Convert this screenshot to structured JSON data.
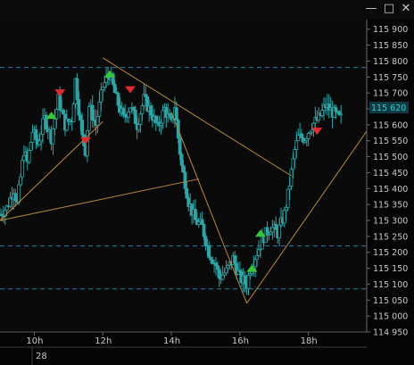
{
  "window": {
    "minimize_glyph": "—",
    "maximize_glyph": "□",
    "close_glyph": "✕"
  },
  "colors": {
    "background": "#0a0a0a",
    "candle": "#2aa6a6",
    "trendline": "#b98a3a",
    "hline": "#1f7fa8",
    "buy_marker": "#35c935",
    "sell_marker": "#e02b2b",
    "price_label_bg": "#0d3a45",
    "price_label_text": "#2fd0d0"
  },
  "chart_data": {
    "type": "candlestick",
    "current_price": "115 620",
    "y_ticks": [
      "115 900",
      "115 850",
      "115 800",
      "115 750",
      "115 700",
      "115 650",
      "115 600",
      "115 550",
      "115 500",
      "115 450",
      "115 400",
      "115 350",
      "115 300",
      "115 250",
      "115 200",
      "115 150",
      "115 100",
      "115 050",
      "115 000",
      "114 950"
    ],
    "ylim": [
      114950,
      115930
    ],
    "x_ticks": [
      {
        "label": "10h",
        "hour": 10
      },
      {
        "label": "12h",
        "hour": 12
      },
      {
        "label": "14h",
        "hour": 14
      },
      {
        "label": "16h",
        "hour": 16
      },
      {
        "label": "18h",
        "hour": 18
      }
    ],
    "xlim_hours": [
      9,
      19.7
    ],
    "day_label": "28",
    "price_series": [
      [
        9.0,
        115320
      ],
      [
        9.2,
        115340
      ],
      [
        9.4,
        115400
      ],
      [
        9.5,
        115350
      ],
      [
        9.7,
        115520
      ],
      [
        9.8,
        115480
      ],
      [
        9.95,
        115580
      ],
      [
        10.1,
        115540
      ],
      [
        10.3,
        115620
      ],
      [
        10.5,
        115560
      ],
      [
        10.7,
        115680
      ],
      [
        10.9,
        115600
      ],
      [
        11.1,
        115620
      ],
      [
        11.2,
        115740
      ],
      [
        11.4,
        115560
      ],
      [
        11.5,
        115520
      ],
      [
        11.6,
        115660
      ],
      [
        11.8,
        115600
      ],
      [
        12.0,
        115720
      ],
      [
        12.2,
        115760
      ],
      [
        12.4,
        115680
      ],
      [
        12.6,
        115620
      ],
      [
        12.8,
        115660
      ],
      [
        13.0,
        115600
      ],
      [
        13.2,
        115680
      ],
      [
        13.4,
        115640
      ],
      [
        13.6,
        115590
      ],
      [
        13.8,
        115650
      ],
      [
        14.0,
        115600
      ],
      [
        14.1,
        115660
      ],
      [
        14.2,
        115560
      ],
      [
        14.3,
        115470
      ],
      [
        14.4,
        115420
      ],
      [
        14.5,
        115360
      ],
      [
        14.7,
        115300
      ],
      [
        14.9,
        115280
      ],
      [
        15.1,
        115200
      ],
      [
        15.3,
        115160
      ],
      [
        15.4,
        115120
      ],
      [
        15.6,
        115140
      ],
      [
        15.8,
        115180
      ],
      [
        16.0,
        115120
      ],
      [
        16.2,
        115100
      ],
      [
        16.3,
        115150
      ],
      [
        16.5,
        115200
      ],
      [
        16.7,
        115250
      ],
      [
        16.9,
        115280
      ],
      [
        17.1,
        115260
      ],
      [
        17.3,
        115320
      ],
      [
        17.4,
        115380
      ],
      [
        17.5,
        115450
      ],
      [
        17.6,
        115520
      ],
      [
        17.7,
        115560
      ],
      [
        17.9,
        115560
      ],
      [
        18.1,
        115600
      ],
      [
        18.3,
        115620
      ],
      [
        18.5,
        115660
      ],
      [
        18.7,
        115640
      ],
      [
        18.9,
        115620
      ]
    ],
    "horizontal_lines": [
      115780,
      115220,
      115085
    ],
    "trend_lines": [
      {
        "from": [
          9.0,
          115300
        ],
        "to": [
          12.0,
          115610
        ]
      },
      {
        "from": [
          9.0,
          115300
        ],
        "to": [
          14.8,
          115430
        ]
      },
      {
        "from": [
          12.0,
          115810
        ],
        "to": [
          17.5,
          115440
        ]
      },
      {
        "from": [
          14.0,
          115640
        ],
        "to": [
          16.2,
          115040
        ]
      },
      {
        "from": [
          16.2,
          115040
        ],
        "to": [
          19.7,
          115580
        ]
      }
    ],
    "signals": [
      {
        "type": "buy",
        "hour": 10.5,
        "price": 115630
      },
      {
        "type": "sell",
        "hour": 10.75,
        "price": 115700
      },
      {
        "type": "sell",
        "hour": 11.5,
        "price": 115550
      },
      {
        "type": "buy",
        "hour": 12.2,
        "price": 115760
      },
      {
        "type": "sell",
        "hour": 12.8,
        "price": 115710
      },
      {
        "type": "buy",
        "hour": 16.35,
        "price": 115150
      },
      {
        "type": "buy",
        "hour": 16.6,
        "price": 115260
      },
      {
        "type": "sell",
        "hour": 18.25,
        "price": 115580
      }
    ]
  }
}
